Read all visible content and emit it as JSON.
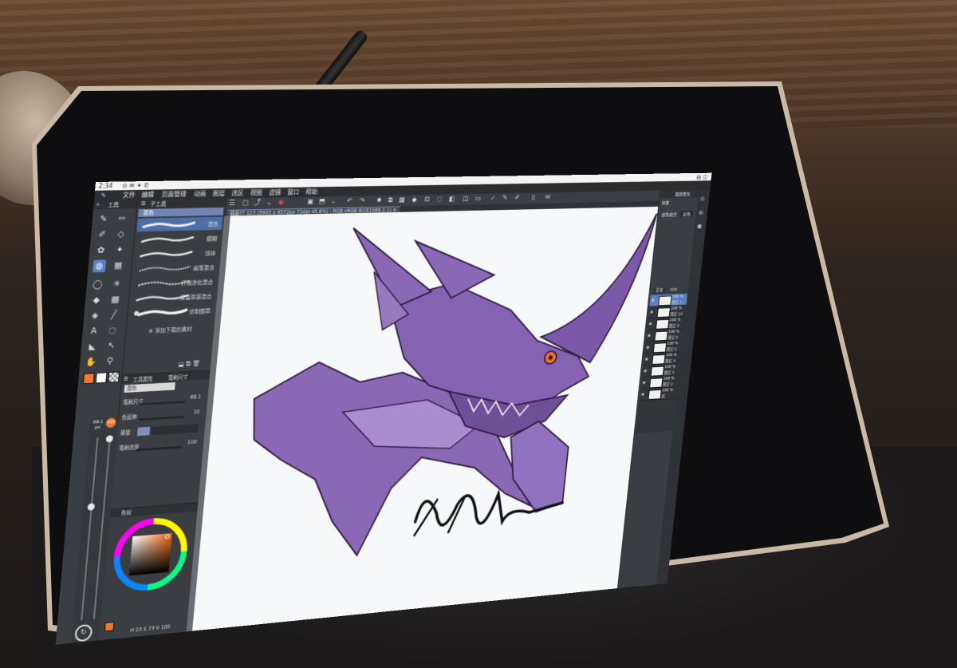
{
  "status": {
    "time": "2:34"
  },
  "menu": [
    "文件",
    "编辑",
    "页面管理",
    "动画",
    "图层",
    "选区",
    "视图",
    "滤镜",
    "窗口",
    "帮助"
  ],
  "doc_tab": "插画?? 123 (5905 x 4572px 72dpi 45.6%) : RGB sRGB IEC61966-2.1)",
  "tool_panel": {
    "title": "工具"
  },
  "subtool": {
    "title": "子工具",
    "group": "混色",
    "brushes": [
      "混色",
      "模糊",
      "涂抹",
      "画笔混合",
      "纤维渗化混合",
      "保留质感混合",
      "仿制图章"
    ],
    "add": "添加下载的素材"
  },
  "properties": {
    "title": "工具属性",
    "tab": "笔刷尺寸",
    "brush_name": "混色",
    "rows": [
      {
        "label": "笔刷尺寸",
        "value": "68.1"
      },
      {
        "label": "色延伸",
        "value": "10"
      },
      {
        "label": "硬度",
        "value": ""
      },
      {
        "label": "笔刷浓度",
        "value": "100"
      }
    ]
  },
  "size_panel": {
    "size": "68.1",
    "unit": "px",
    "opacity": "100"
  },
  "color_panel": {
    "title": "色轮",
    "values": [
      "23",
      "73",
      "100"
    ],
    "fg": "#ee7a2c",
    "bg": "#ffffff"
  },
  "right_panel": {
    "title": "图层属性",
    "label": "效果",
    "blend_label": "颜色模式",
    "blend_value": "彩色",
    "layer_mode": "正常",
    "layer_opacity": "100",
    "layers": [
      {
        "pct": "100 %",
        "name": "图层 1"
      },
      {
        "pct": "100 %",
        "name": "图层 10"
      },
      {
        "pct": "100 %",
        "name": "图层 9"
      },
      {
        "pct": "100 %",
        "name": "图层 8"
      },
      {
        "pct": "100 %",
        "name": "图层 6"
      },
      {
        "pct": "100 %",
        "name": "图层 4"
      },
      {
        "pct": "100 %",
        "name": "图层 3"
      },
      {
        "pct": "100 %",
        "name": "图层 2"
      },
      {
        "pct": "100 %",
        "name": "纸"
      }
    ]
  },
  "colors": {
    "accent": "#5b7fc0",
    "dragon": "#8a68b5",
    "panel": "#3a3d42"
  }
}
